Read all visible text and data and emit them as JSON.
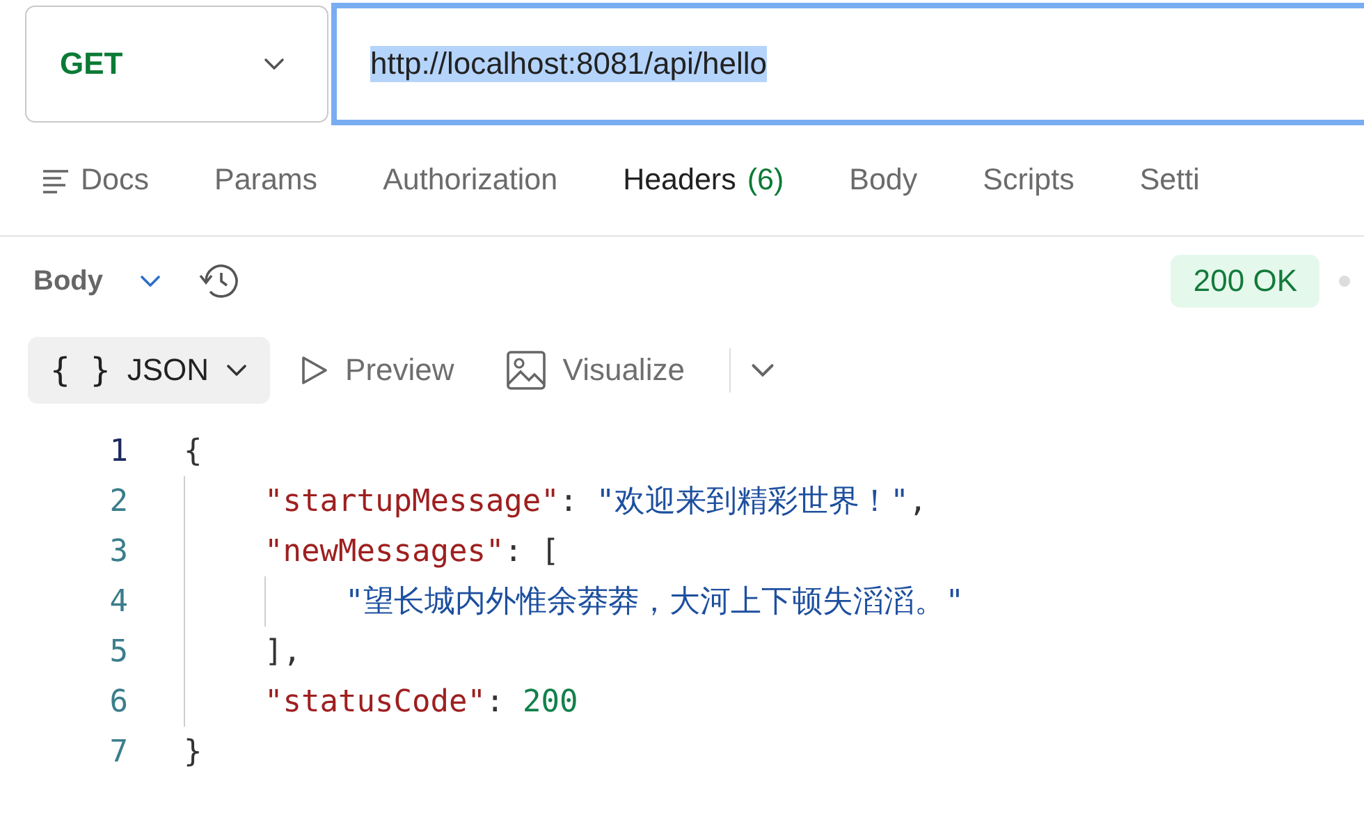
{
  "request": {
    "method": "GET",
    "url": "http://localhost:8081/api/hello",
    "url_focused": true,
    "url_highlighted": true
  },
  "tabs": [
    {
      "label": "Docs",
      "kind": "docs",
      "selected": false
    },
    {
      "label": "Params",
      "kind": "plain",
      "selected": false
    },
    {
      "label": "Authorization",
      "kind": "plain",
      "selected": false
    },
    {
      "label": "Headers",
      "count": "(6)",
      "kind": "plain",
      "selected": true
    },
    {
      "label": "Body",
      "kind": "plain",
      "selected": false
    },
    {
      "label": "Scripts",
      "kind": "plain",
      "selected": false
    },
    {
      "label": "Setti",
      "kind": "plain",
      "selected": false
    }
  ],
  "response": {
    "section": "Body",
    "status": "200 OK",
    "formats": [
      {
        "label": "JSON",
        "glyph": "{ }",
        "kind": "json",
        "selected": true
      },
      {
        "label": "Preview",
        "kind": "preview",
        "selected": false
      },
      {
        "label": "Visualize",
        "kind": "visualize",
        "selected": false
      }
    ],
    "code": [
      {
        "number": "1",
        "current": true,
        "tokens": [
          {
            "kind": "punct",
            "text": "{"
          }
        ],
        "children": [
          {
            "number": "2",
            "current": false,
            "tokens": [
              {
                "kind": "key",
                "text": "\"startupMessage\""
              },
              {
                "kind": "punct",
                "text": ": "
              },
              {
                "kind": "string",
                "text": "\"欢迎来到精彩世界！\""
              },
              {
                "kind": "punct",
                "text": ","
              }
            ]
          },
          {
            "number": "3",
            "current": false,
            "tokens": [
              {
                "kind": "key",
                "text": "\"newMessages\""
              },
              {
                "kind": "punct",
                "text": ": ["
              }
            ],
            "children": [
              {
                "number": "4",
                "current": false,
                "tokens": [
                  {
                    "kind": "string",
                    "text": "\"望长城内外惟余莽莽，大河上下顿失滔滔。\""
                  }
                ]
              }
            ]
          },
          {
            "number": "5",
            "current": false,
            "tokens": [
              {
                "kind": "punct",
                "text": "],"
              }
            ]
          },
          {
            "number": "6",
            "current": false,
            "tokens": [
              {
                "kind": "key",
                "text": "\"statusCode\""
              },
              {
                "kind": "punct",
                "text": ": "
              },
              {
                "kind": "number",
                "text": "200"
              }
            ]
          }
        ]
      },
      {
        "number": "7",
        "current": false,
        "tokens": [
          {
            "kind": "punct",
            "text": "}"
          }
        ]
      }
    ]
  }
}
